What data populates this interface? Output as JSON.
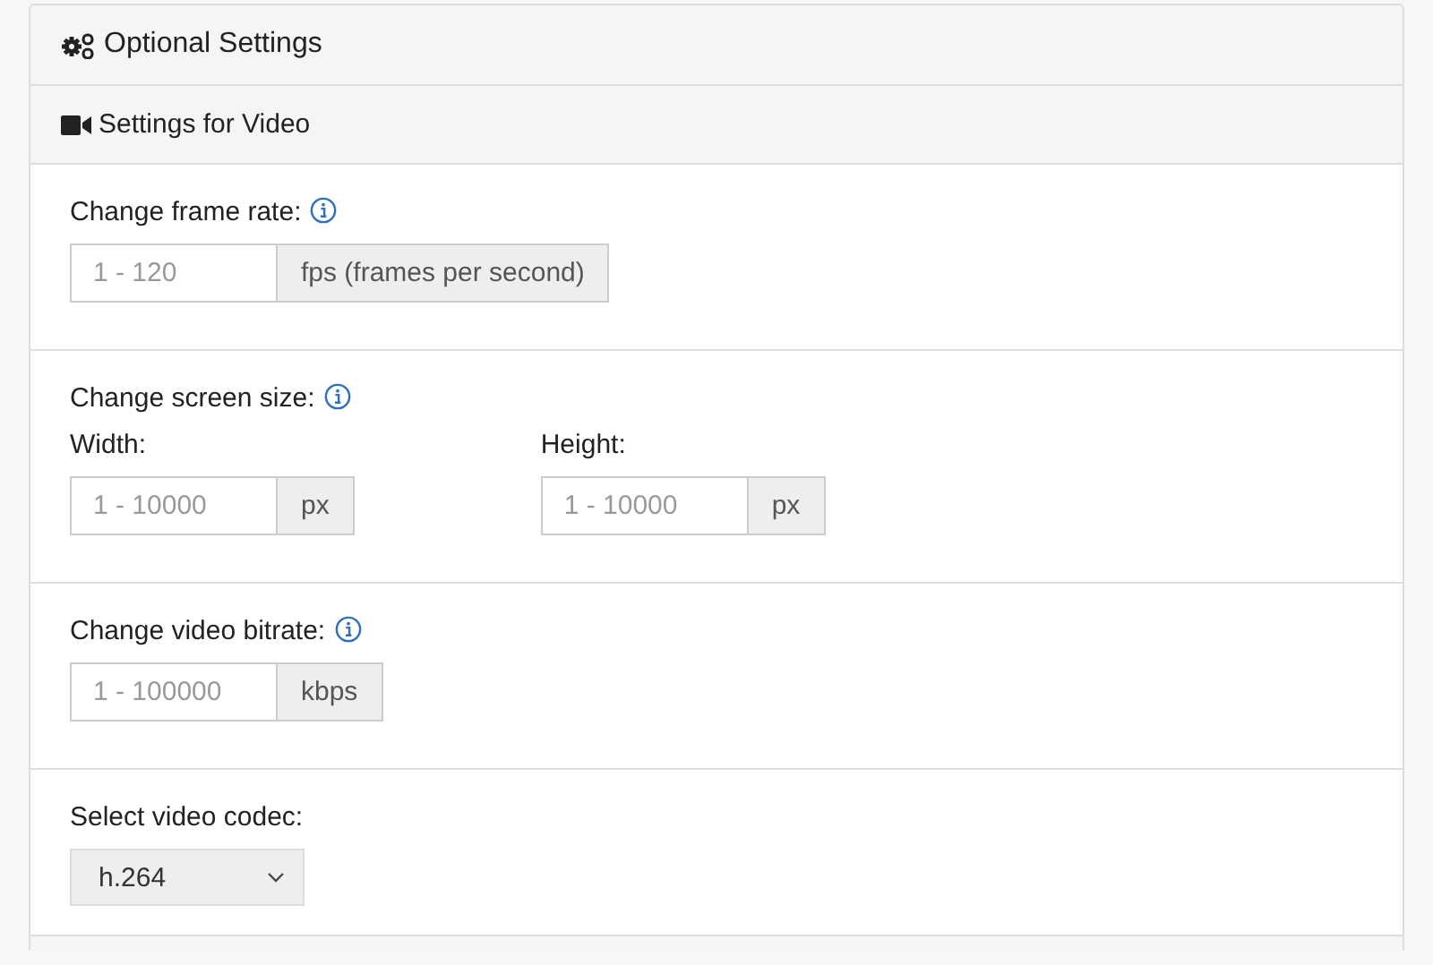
{
  "panel": {
    "title": "Optional Settings"
  },
  "subpanel": {
    "title": "Settings for Video"
  },
  "sections": [
    {
      "kind": "single",
      "label": "Change frame rate:",
      "info": true,
      "fields": [
        {
          "placeholder": "1 - 120",
          "unit": "fps (frames per second)"
        }
      ]
    },
    {
      "kind": "pair",
      "label": "Change screen size:",
      "info": true,
      "fields": [
        {
          "label": "Width:",
          "placeholder": "1 - 10000",
          "unit": "px"
        },
        {
          "label": "Height:",
          "placeholder": "1 - 10000",
          "unit": "px"
        }
      ]
    },
    {
      "kind": "single",
      "label": "Change video bitrate:",
      "info": true,
      "fields": [
        {
          "placeholder": "1 - 100000",
          "unit": "kbps"
        }
      ]
    },
    {
      "kind": "select",
      "label": "Select video codec:",
      "info": false,
      "value": "h.264"
    }
  ]
}
